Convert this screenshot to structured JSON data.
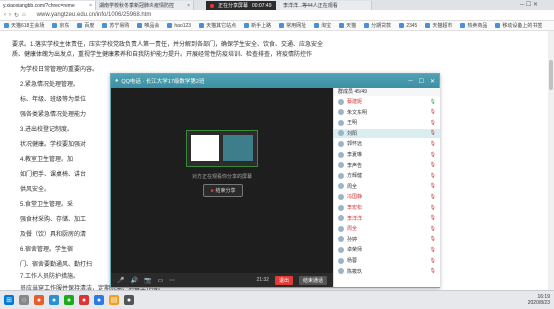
{
  "tabs": [
    {
      "label": "y.xiaoxiangbb.com/?chrec=reme"
    },
    {
      "label": "湖南学校秋冬季新冠肺炎疫情防控"
    },
    {
      "label": "正在分享屏幕"
    },
    {
      "label": "李洋洋...等44人正在观看"
    }
  ],
  "recording": {
    "label": "正在分享屏幕",
    "time": "00:07:49"
  },
  "browser": {
    "url": "www.yangtzeu.edu.cn/info/1006/25968.htm",
    "bookmarks": [
      "天猫618主会场",
      "京东",
      "百度",
      "苏宁易购",
      "唯品会",
      "hao123",
      "天猫其它站点",
      "新手上路",
      "常用网址",
      "淘宝",
      "天猫",
      "分期贷款",
      "2345",
      "天猫超市",
      "热卖商品",
      "移动设备上的书签"
    ]
  },
  "page": {
    "lines": [
      "要求。1.落实学校主体责任，压实学校党政负责人第一责任，并分解到各部门，确保学生安全、饮食、交通、应急安全",
      "质、健康体魄为出发点，重视学生健康素养和自我防护能力提升。开展经常性防疫培训、检查排查，将疫情防控作",
      "为学校日常管理的重要内容。",
      "2.紧急情况处理管理。",
      "标、年级、班级等为单位",
      "强各类紧急情况处理能力",
      "3.进出校登记制度。",
      "状况健康。学校要加强对",
      "4.教室卫生管理。加",
      "如门把手、课桌椅、讲台",
      "供风安全。",
      "5.食堂卫生管理。采",
      "强食材采购、存储、加工",
      "及餐（饮）具和厨房的清",
      "6.宿舍管理。学生宿",
      "门、宿舍要勤通风、勤打扫",
      "7.工作人员防护措施。",
      "员应当穿工作服并保持清洁，定期洗涤、消毒工作服。"
    ]
  },
  "qq": {
    "title": "QQ电话 · 长江大学17级数学第2班",
    "sharing_text": "对方正在观看你分享的屏幕",
    "end_share": "结束分享",
    "call_time": "21:32",
    "exit": "退出",
    "end_call": "结束通话",
    "members_header": "群成员 45/49",
    "members": [
      {
        "name": "蔡建妮",
        "color": "#d32f2f"
      },
      {
        "name": "朱文东明",
        "color": "#333333"
      },
      {
        "name": "王明",
        "color": "#333333"
      },
      {
        "name": "刘阳",
        "color": "#333333"
      },
      {
        "name": "郭怀远",
        "color": "#333333"
      },
      {
        "name": "李夏琳",
        "color": "#333333"
      },
      {
        "name": "李声告",
        "color": "#333333"
      },
      {
        "name": "方辉健",
        "color": "#333333"
      },
      {
        "name": "周全",
        "color": "#333333"
      },
      {
        "name": "冯国静",
        "color": "#d32f2f"
      },
      {
        "name": "李宏松",
        "color": "#d32f2f"
      },
      {
        "name": "李洋洋",
        "color": "#d32f2f"
      },
      {
        "name": "周全",
        "color": "#d32f2f"
      },
      {
        "name": "孙婷",
        "color": "#333333"
      },
      {
        "name": "卓荣师",
        "color": "#333333"
      },
      {
        "name": "杨蓉",
        "color": "#333333"
      },
      {
        "name": "陈筱玖",
        "color": "#333333"
      }
    ]
  },
  "clock": {
    "time": "16:19",
    "date": "2020/8/23"
  }
}
